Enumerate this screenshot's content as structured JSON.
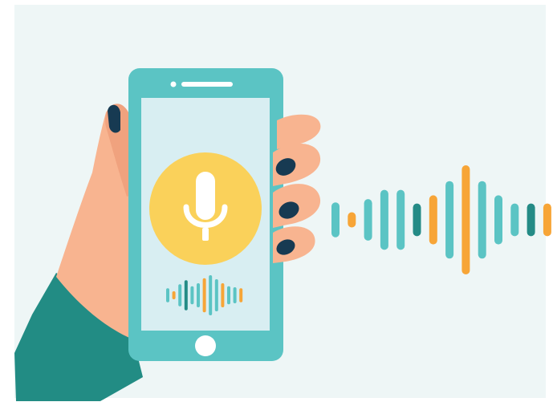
{
  "scene": {
    "description_icon": "voice-assistant-illustration",
    "colors": {
      "background": "#eef6f6",
      "frame": "#ffffff",
      "phone_body": "#5bc4c4",
      "phone_screen": "#d8eef2",
      "mic_circle": "#fad15a",
      "mic_body": "#ffffff",
      "skin": "#f8b490",
      "skin_shadow": "#f0a27e",
      "nail": "#173a52",
      "sleeve": "#228c84",
      "wave_teal": "#5bc4c4",
      "wave_dark": "#248b86",
      "wave_orange": "#f7a537"
    },
    "icons": {
      "microphone": "microphone-icon",
      "home_button": "home-button-icon",
      "speaker": "speaker-slot-icon"
    }
  },
  "sound_wave": {
    "levels": [
      0.32,
      0.14,
      0.38,
      0.55,
      0.55,
      0.3,
      0.45,
      0.71,
      1.0,
      0.71,
      0.45,
      0.3,
      0.3,
      0.3
    ],
    "colors": [
      "teal",
      "orange",
      "teal",
      "teal",
      "teal",
      "dark",
      "orange",
      "teal",
      "orange",
      "teal",
      "teal",
      "teal",
      "dark",
      "orange"
    ]
  },
  "screen_wave": {
    "levels": [
      0.35,
      0.2,
      0.55,
      0.75,
      0.45,
      0.6,
      0.85,
      1.0,
      0.8,
      0.6,
      0.45,
      0.4,
      0.35
    ],
    "colors": [
      "teal",
      "orange",
      "teal",
      "dark",
      "teal",
      "teal",
      "orange",
      "teal",
      "teal",
      "orange",
      "teal",
      "teal",
      "orange"
    ]
  }
}
